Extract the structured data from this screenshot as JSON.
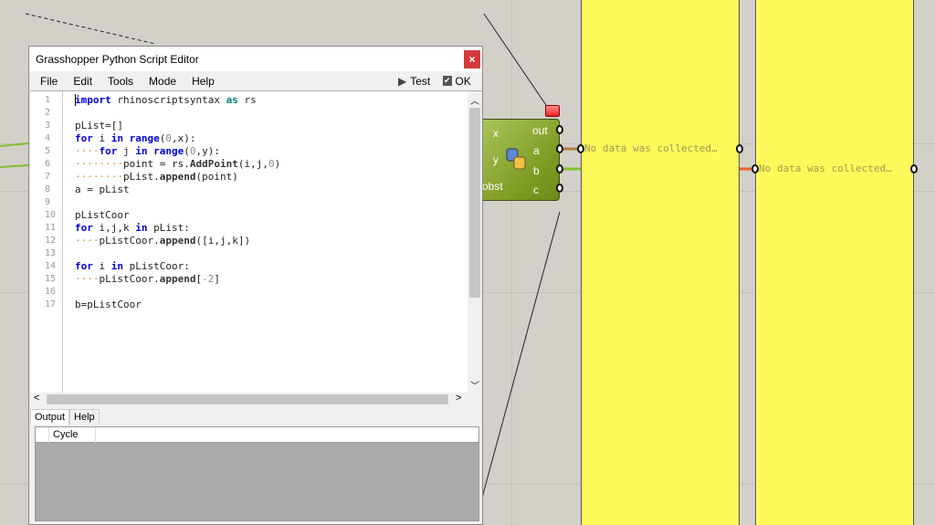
{
  "window": {
    "title": "Grasshopper Python Script Editor",
    "close": "×"
  },
  "menu": [
    "File",
    "Edit",
    "Tools",
    "Mode",
    "Help"
  ],
  "toolbar": {
    "test": "Test",
    "ok": "OK"
  },
  "code": [
    [
      [
        "import",
        "kw"
      ],
      " rhinoscriptsyntax ",
      [
        "as",
        "as"
      ],
      " rs"
    ],
    [],
    [
      "pList=[]"
    ],
    [
      [
        "for",
        "kw"
      ],
      " i ",
      [
        "in",
        "kw"
      ],
      " ",
      [
        "range",
        "kw"
      ],
      "(",
      [
        "0",
        "num"
      ],
      ",x):"
    ],
    [
      [
        "····",
        "dot"
      ],
      [
        "for",
        "kw"
      ],
      " j ",
      [
        "in",
        "kw"
      ],
      " ",
      [
        "range",
        "kw"
      ],
      "(",
      [
        "0",
        "num"
      ],
      ",y):"
    ],
    [
      [
        "········",
        "dot"
      ],
      "point = rs.",
      [
        "AddPoint",
        "fn"
      ],
      "(i,j,",
      [
        "0",
        "num"
      ],
      ")"
    ],
    [
      [
        "········",
        "dot"
      ],
      "pList.",
      [
        "append",
        "fn"
      ],
      "(point)"
    ],
    [
      "a = pList"
    ],
    [],
    [
      "pListCoor"
    ],
    [
      [
        "for",
        "kw"
      ],
      " i,j,k ",
      [
        "in",
        "kw"
      ],
      " pList:"
    ],
    [
      [
        "····",
        "dot"
      ],
      "pListCoor.",
      [
        "append",
        "fn"
      ],
      "([i,j,k])"
    ],
    [],
    [
      [
        "for",
        "kw"
      ],
      " i ",
      [
        "in",
        "kw"
      ],
      " pListCoor:"
    ],
    [
      [
        "····",
        "dot"
      ],
      "pListCoor.",
      [
        "append",
        "fn"
      ],
      "[",
      [
        "-2",
        "num"
      ],
      "]"
    ],
    [],
    [
      "b=pListCoor"
    ]
  ],
  "output": {
    "tabs": [
      "Output",
      "Help"
    ],
    "column": "Cycle"
  },
  "component": {
    "inputs": [
      "x",
      "y",
      "obst"
    ],
    "outputs": [
      "out",
      "a",
      "b",
      "c"
    ]
  },
  "panels": {
    "message": "No data was collected…"
  }
}
